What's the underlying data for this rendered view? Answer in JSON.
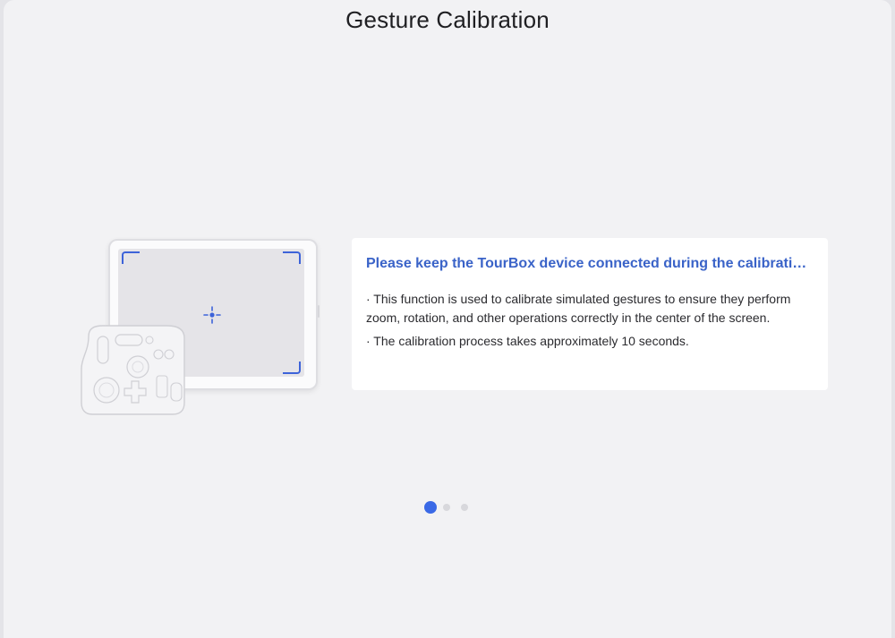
{
  "window": {
    "title": "Gesture Calibration"
  },
  "illustration": {
    "tablet_icon": "tablet-with-target-corners",
    "crosshair_icon": "crosshair-icon",
    "controller_icon": "tourbox-controller-icon"
  },
  "info": {
    "heading": "Please keep the TourBox device connected during the calibration process.",
    "items": [
      "· This function is used to calibrate simulated gestures to ensure they perform zoom, rotation, and other operations correctly in the center of the screen.",
      "· The calibration process takes approximately 10 seconds."
    ]
  },
  "pagination": {
    "total": 3,
    "current": 1
  },
  "colors": {
    "accent": "#3a69e6",
    "heading": "#3a63c8",
    "background": "#f2f2f4",
    "card": "#ffffff",
    "dot_inactive": "#d8d8dc"
  }
}
